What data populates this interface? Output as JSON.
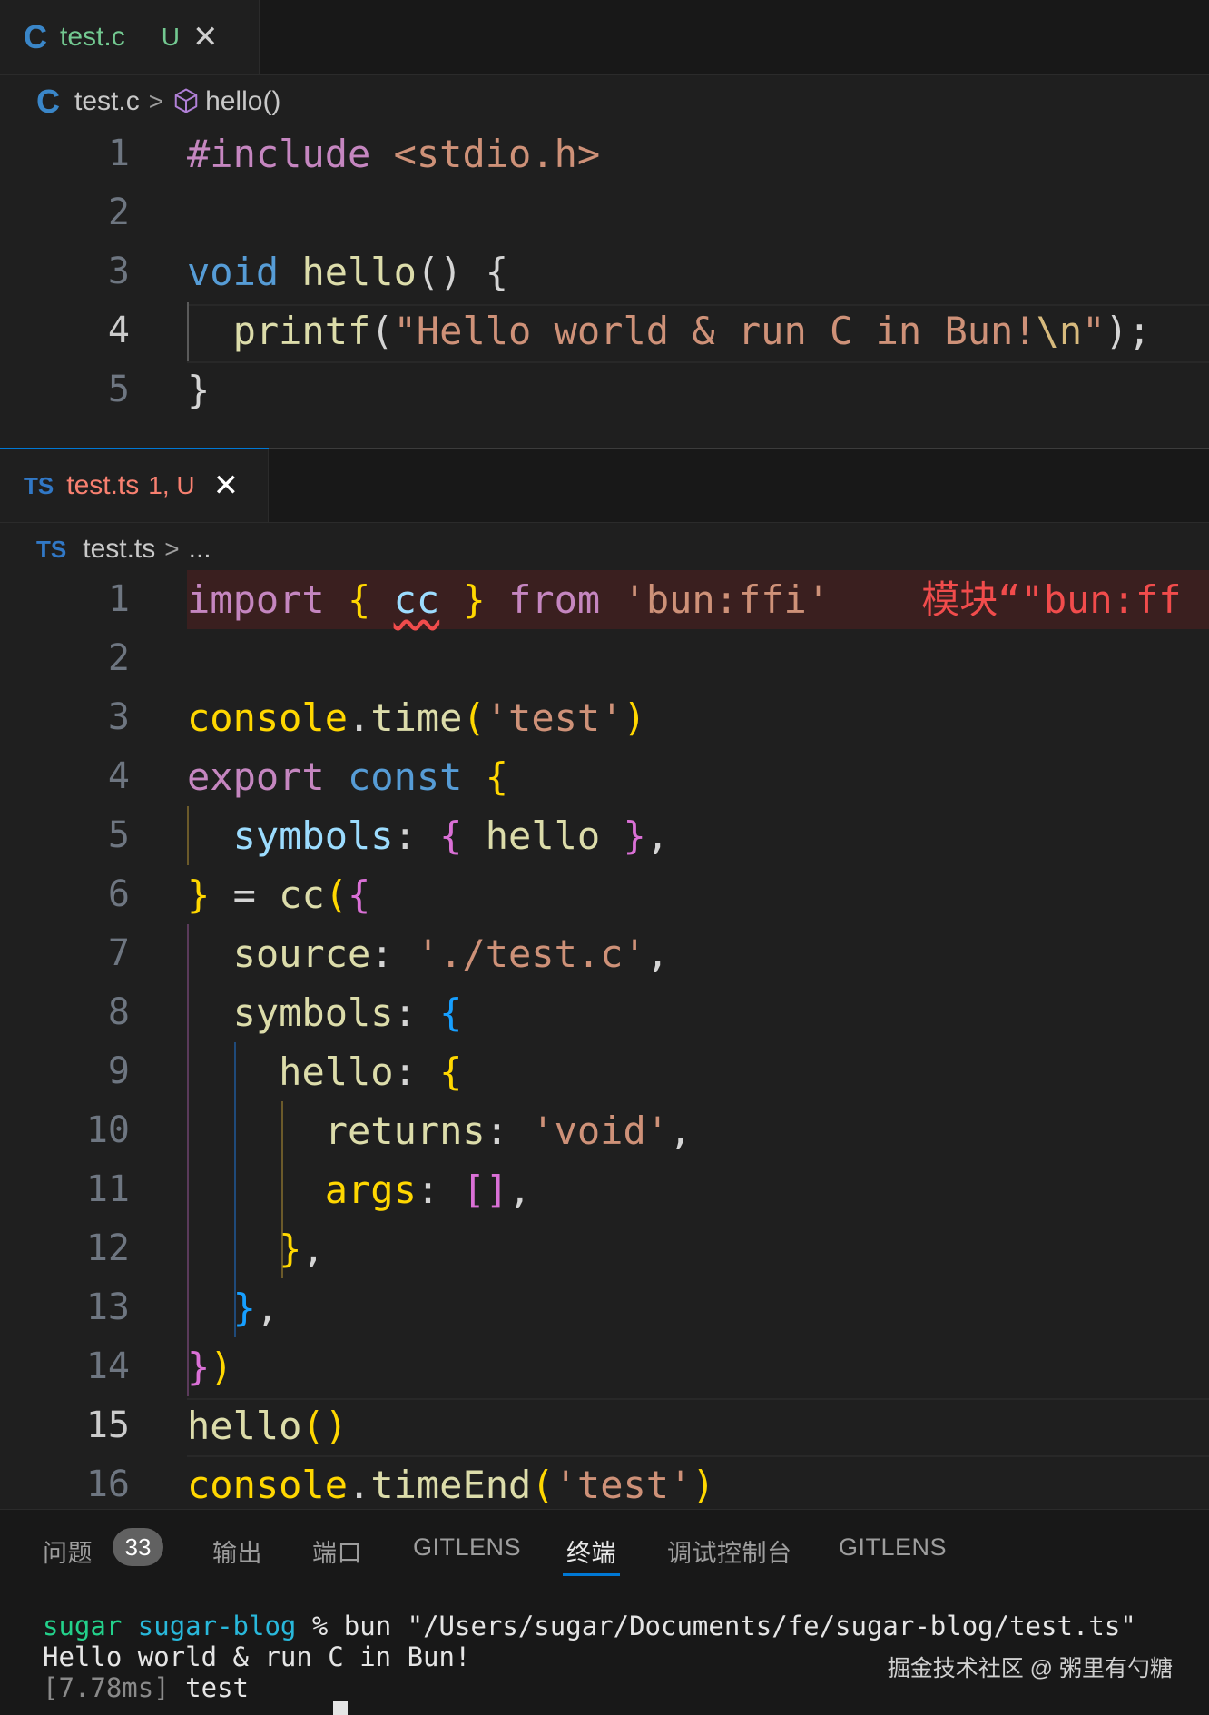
{
  "colors": {
    "c_icon": "#3a86c8",
    "ts_icon": "#3178c6",
    "untracked": "#73c991",
    "error": "#f14c4c",
    "accent": "#0078d4"
  },
  "top_editor": {
    "tab": {
      "icon": "C",
      "name": "test.c",
      "status": "U",
      "close": "✕"
    },
    "breadcrumb": {
      "icon": "C",
      "file": "test.c",
      "sep": ">",
      "symbol_icon": "cube-icon",
      "symbol": "hello()"
    },
    "lines": [
      {
        "n": "1",
        "tokens": [
          {
            "t": "#include",
            "c": "kw"
          },
          {
            "t": " ",
            "c": "plain"
          },
          {
            "t": "<stdio.h>",
            "c": "str"
          }
        ]
      },
      {
        "n": "2",
        "tokens": []
      },
      {
        "n": "3",
        "tokens": [
          {
            "t": "void",
            "c": "blue"
          },
          {
            "t": " ",
            "c": "plain"
          },
          {
            "t": "hello",
            "c": "fn"
          },
          {
            "t": "() {",
            "c": "plain"
          }
        ]
      },
      {
        "n": "4",
        "tokens": [
          {
            "t": "  ",
            "c": "plain"
          },
          {
            "t": "printf",
            "c": "fn"
          },
          {
            "t": "(",
            "c": "plain"
          },
          {
            "t": "\"Hello world & run C in Bun!",
            "c": "str"
          },
          {
            "t": "\\n",
            "c": "esc"
          },
          {
            "t": "\"",
            "c": "str"
          },
          {
            "t": ");",
            "c": "plain"
          }
        ]
      },
      {
        "n": "5",
        "tokens": [
          {
            "t": "}",
            "c": "plain"
          }
        ]
      }
    ]
  },
  "bottom_editor": {
    "tab": {
      "icon": "TS",
      "name": "test.ts",
      "status": "1, U",
      "close": "✕"
    },
    "breadcrumb": {
      "icon": "TS",
      "file": "test.ts",
      "sep": ">",
      "rest": "..."
    },
    "lines": [
      {
        "n": "1",
        "tokens": [
          {
            "t": "import",
            "c": "kw"
          },
          {
            "t": " ",
            "c": "plain"
          },
          {
            "t": "{",
            "c": "b1"
          },
          {
            "t": " ",
            "c": "plain"
          },
          {
            "t": "cc",
            "c": "var squig"
          },
          {
            "t": " ",
            "c": "plain"
          },
          {
            "t": "}",
            "c": "b1"
          },
          {
            "t": " ",
            "c": "plain"
          },
          {
            "t": "from",
            "c": "kw"
          },
          {
            "t": " ",
            "c": "plain"
          },
          {
            "t": "'bun:ffi'",
            "c": "str"
          },
          {
            "t": "    模块“\"bun:ff",
            "c": "err"
          }
        ]
      },
      {
        "n": "2",
        "tokens": []
      },
      {
        "n": "3",
        "tokens": [
          {
            "t": "console",
            "c": "b1"
          },
          {
            "t": ".",
            "c": "plain"
          },
          {
            "t": "time",
            "c": "fn"
          },
          {
            "t": "(",
            "c": "b1"
          },
          {
            "t": "'test'",
            "c": "str"
          },
          {
            "t": ")",
            "c": "b1"
          }
        ]
      },
      {
        "n": "4",
        "tokens": [
          {
            "t": "export",
            "c": "kw"
          },
          {
            "t": " ",
            "c": "plain"
          },
          {
            "t": "const",
            "c": "blue"
          },
          {
            "t": " ",
            "c": "plain"
          },
          {
            "t": "{",
            "c": "b1"
          }
        ]
      },
      {
        "n": "5",
        "tokens": [
          {
            "t": "  ",
            "c": "plain"
          },
          {
            "t": "symbols",
            "c": "prop"
          },
          {
            "t": ": ",
            "c": "plain"
          },
          {
            "t": "{",
            "c": "b2"
          },
          {
            "t": " ",
            "c": "plain"
          },
          {
            "t": "hello",
            "c": "fn"
          },
          {
            "t": " ",
            "c": "plain"
          },
          {
            "t": "}",
            "c": "b2"
          },
          {
            "t": ",",
            "c": "plain"
          }
        ]
      },
      {
        "n": "6",
        "tokens": [
          {
            "t": "}",
            "c": "b1"
          },
          {
            "t": " = ",
            "c": "plain"
          },
          {
            "t": "cc",
            "c": "fn"
          },
          {
            "t": "(",
            "c": "b1"
          },
          {
            "t": "{",
            "c": "b2"
          }
        ]
      },
      {
        "n": "7",
        "tokens": [
          {
            "t": "  ",
            "c": "plain"
          },
          {
            "t": "source",
            "c": "fn"
          },
          {
            "t": ": ",
            "c": "plain"
          },
          {
            "t": "'./test.c'",
            "c": "str"
          },
          {
            "t": ",",
            "c": "plain"
          }
        ]
      },
      {
        "n": "8",
        "tokens": [
          {
            "t": "  ",
            "c": "plain"
          },
          {
            "t": "symbols",
            "c": "fn"
          },
          {
            "t": ": ",
            "c": "plain"
          },
          {
            "t": "{",
            "c": "b3"
          }
        ]
      },
      {
        "n": "9",
        "tokens": [
          {
            "t": "    ",
            "c": "plain"
          },
          {
            "t": "hello",
            "c": "fn"
          },
          {
            "t": ": ",
            "c": "plain"
          },
          {
            "t": "{",
            "c": "b1"
          }
        ]
      },
      {
        "n": "10",
        "tokens": [
          {
            "t": "      ",
            "c": "plain"
          },
          {
            "t": "returns",
            "c": "fn"
          },
          {
            "t": ": ",
            "c": "plain"
          },
          {
            "t": "'void'",
            "c": "str"
          },
          {
            "t": ",",
            "c": "plain"
          }
        ]
      },
      {
        "n": "11",
        "tokens": [
          {
            "t": "      ",
            "c": "plain"
          },
          {
            "t": "args",
            "c": "b1"
          },
          {
            "t": ": ",
            "c": "plain"
          },
          {
            "t": "[]",
            "c": "b2"
          },
          {
            "t": ",",
            "c": "plain"
          }
        ]
      },
      {
        "n": "12",
        "tokens": [
          {
            "t": "    ",
            "c": "plain"
          },
          {
            "t": "}",
            "c": "b1"
          },
          {
            "t": ",",
            "c": "plain"
          }
        ]
      },
      {
        "n": "13",
        "tokens": [
          {
            "t": "  ",
            "c": "plain"
          },
          {
            "t": "}",
            "c": "b3"
          },
          {
            "t": ",",
            "c": "plain"
          }
        ]
      },
      {
        "n": "14",
        "tokens": [
          {
            "t": "}",
            "c": "b2"
          },
          {
            "t": ")",
            "c": "b1"
          }
        ]
      },
      {
        "n": "15",
        "tokens": [
          {
            "t": "hello",
            "c": "fn"
          },
          {
            "t": "()",
            "c": "b1"
          }
        ]
      },
      {
        "n": "16",
        "tokens": [
          {
            "t": "console",
            "c": "b1"
          },
          {
            "t": ".",
            "c": "plain"
          },
          {
            "t": "timeEnd",
            "c": "fn"
          },
          {
            "t": "(",
            "c": "b1"
          },
          {
            "t": "'test'",
            "c": "str"
          },
          {
            "t": ")",
            "c": "b1"
          }
        ]
      }
    ]
  },
  "panel": {
    "tabs": [
      {
        "label": "问题",
        "name": "problems"
      },
      {
        "label": "输出",
        "name": "output"
      },
      {
        "label": "端口",
        "name": "ports"
      },
      {
        "label": "GITLENS",
        "name": "gitlens"
      },
      {
        "label": "终端",
        "name": "terminal"
      },
      {
        "label": "调试控制台",
        "name": "debug-console"
      },
      {
        "label": "GITLENS",
        "name": "gitlens-2"
      }
    ],
    "problems_count": "33",
    "terminal": {
      "user": "sugar",
      "dir": "sugar-blog",
      "prompt_symbol": "%",
      "command": "bun \"/Users/sugar/Documents/fe/sugar-blog/test.ts\"",
      "output_line": "Hello world & run C in Bun!",
      "timing": "[7.78ms]",
      "timing_label": "test"
    }
  },
  "watermark": "掘金技术社区 @ 粥里有勺糖"
}
